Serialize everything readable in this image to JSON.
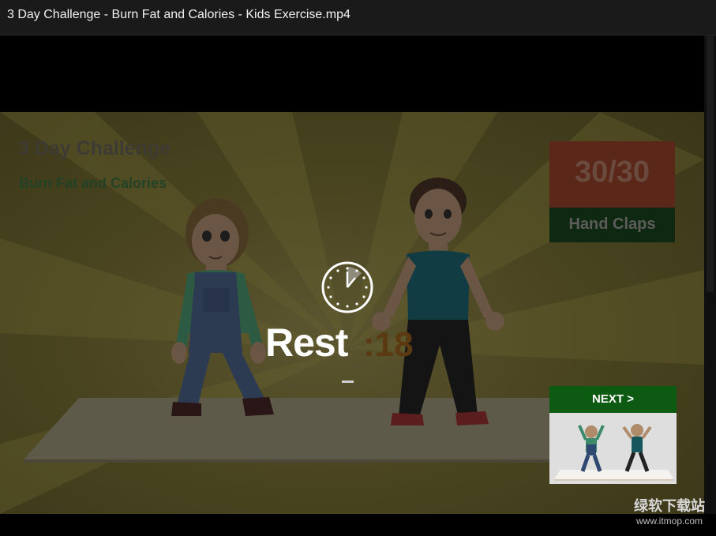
{
  "window": {
    "title": "3 Day Challenge - Burn Fat and Calories - Kids Exercise.mp4"
  },
  "video": {
    "title": "3 Day Challenge",
    "subtitle": "Burn Fat and Calories",
    "counter": {
      "value": "30/30",
      "exercise": "Hand Claps"
    },
    "rest": {
      "label": "Rest",
      "timer": ":18"
    },
    "next": {
      "label": "NEXT >"
    }
  },
  "watermark": {
    "chinese": "绿软下载站",
    "url": "www.itmop.com"
  },
  "colors": {
    "titlebar": "#1a1a1a",
    "next_header": "#0d5a12",
    "counter_top": "#5a2718",
    "counter_bottom": "#0f2812"
  },
  "icons": [
    "clock-icon"
  ]
}
